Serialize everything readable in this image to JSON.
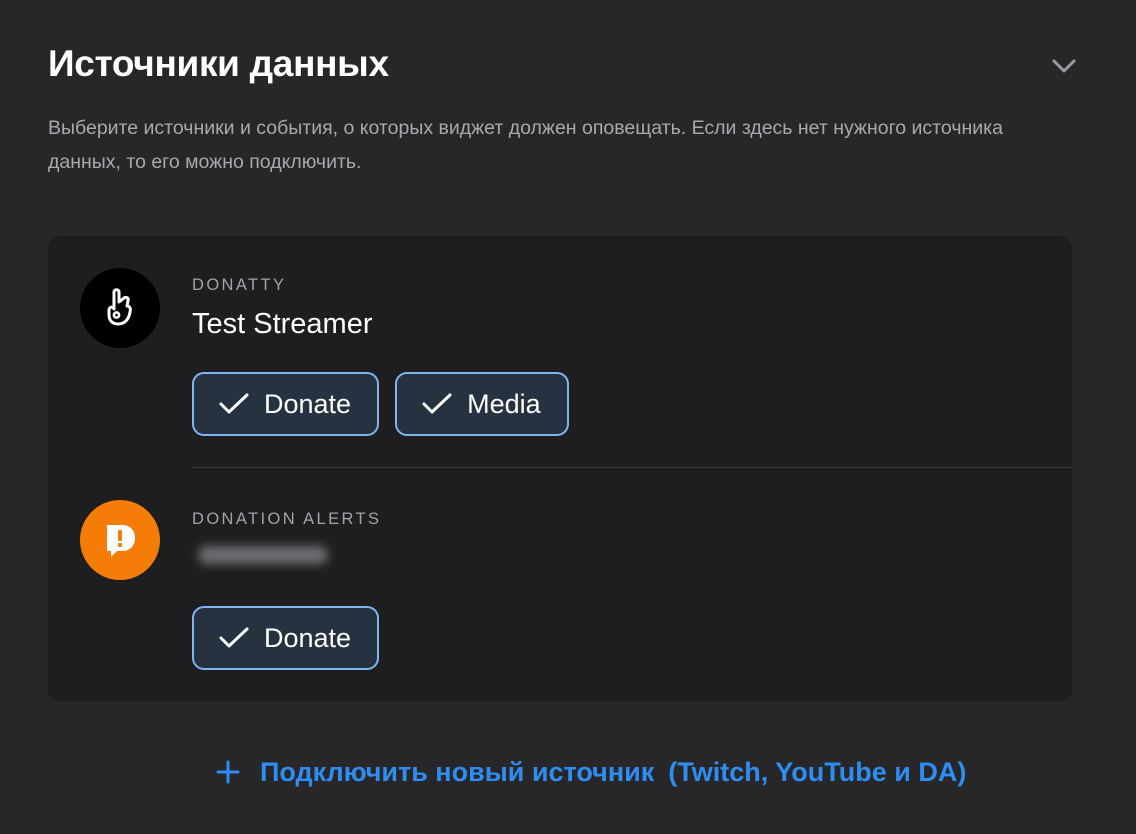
{
  "header": {
    "title": "Источники данных",
    "collapse_icon": "chevron-down-icon"
  },
  "description": "Выберите источники и события, о которых виджет должен оповещать. Если здесь нет нужного источника данных, то его можно подключить.",
  "sources": [
    {
      "provider": "DONATTY",
      "account": "Test Streamer",
      "icon": "donatty-logo-icon",
      "events": [
        {
          "label": "Donate",
          "checked": true
        },
        {
          "label": "Media",
          "checked": true
        }
      ]
    },
    {
      "provider": "DONATION ALERTS",
      "account_hidden": true,
      "icon": "donationalerts-logo-icon",
      "events": [
        {
          "label": "Donate",
          "checked": true
        }
      ]
    }
  ],
  "connect": {
    "label": "Подключить новый источник",
    "hint": "(Twitch, YouTube и DA)",
    "icon": "plus-icon"
  },
  "colors": {
    "panel_bg": "#272729",
    "card_bg": "#1e1e20",
    "chip_bg": "#273240",
    "chip_border": "#7db6f2",
    "link": "#2f8df2",
    "donationalerts_orange": "#f57d07"
  }
}
